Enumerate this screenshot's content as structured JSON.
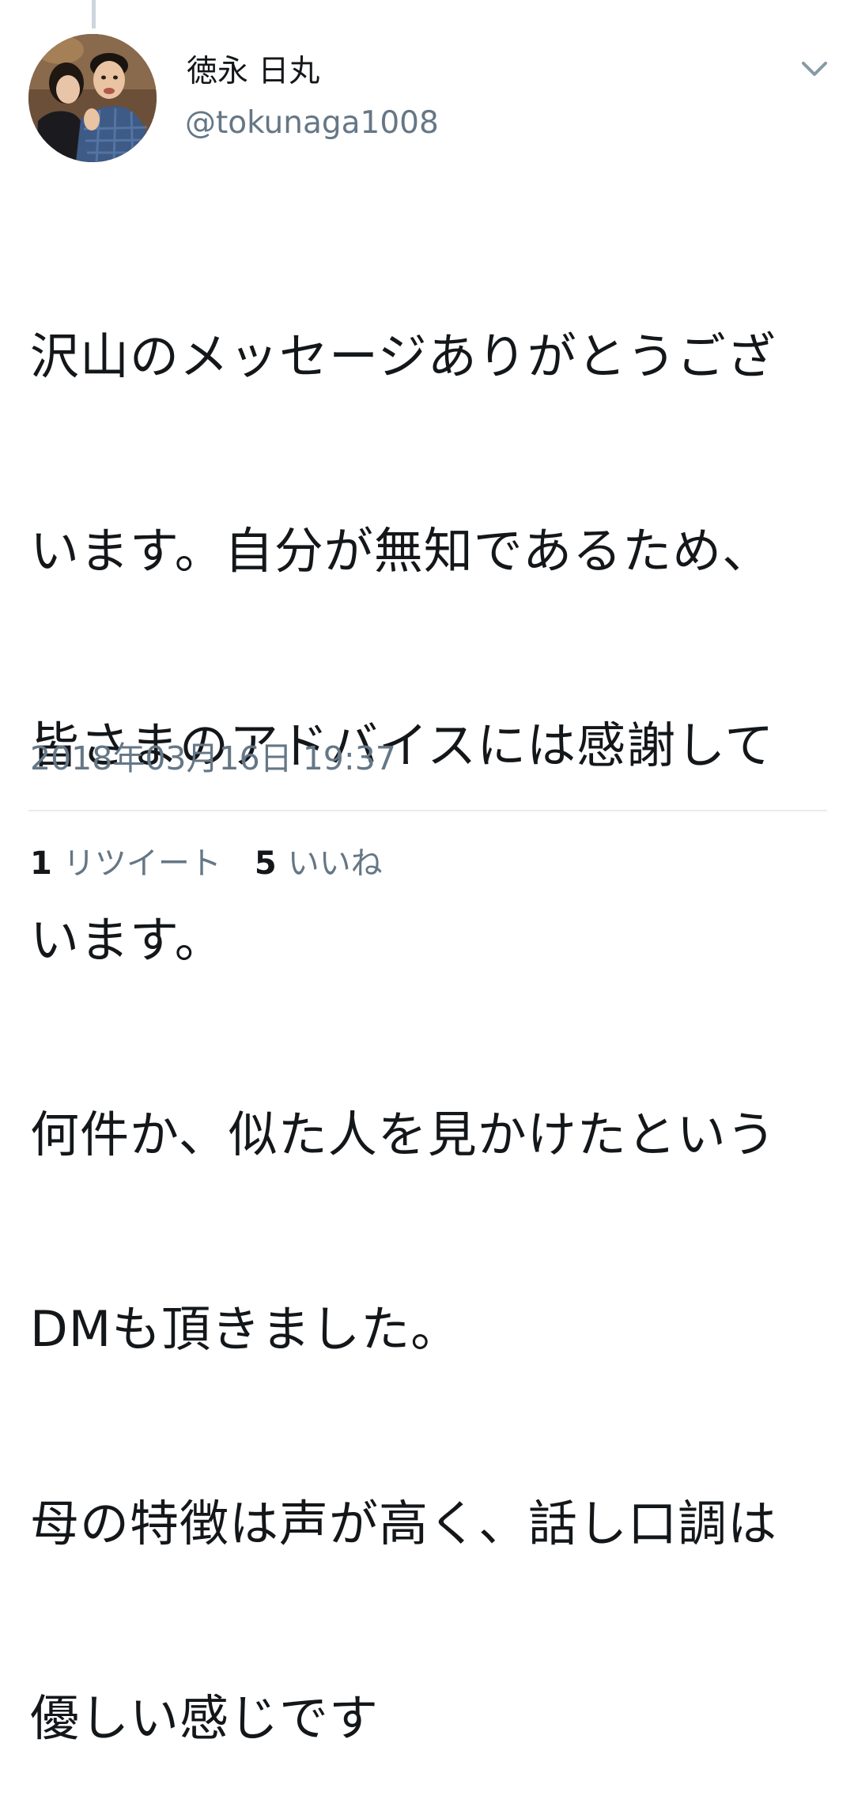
{
  "tweet": {
    "author": {
      "display_name": "徳永 日丸",
      "handle": "@tokunaga1008"
    },
    "text_lines": [
      "沢山のメッセージありがとうござ",
      "います。自分が無知であるため、",
      "皆さまのアドバイスには感謝して",
      "います。",
      "何件か、似た人を見かけたという",
      "DMも頂きました。",
      "母の特徴は声が高く、話し口調は",
      "優しい感じです"
    ],
    "timestamp": "2018年03月16日 19:37",
    "stats": {
      "retweets_count": "1",
      "retweets_label": "リツイート",
      "likes_count": "5",
      "likes_label": "いいね"
    }
  },
  "icons": {
    "menu": "chevron-down-icon",
    "avatar": "profile-photo"
  },
  "colors": {
    "primary_text": "#14171a",
    "secondary_text": "#657786",
    "divider": "#e6ecf0",
    "thread_line": "#ccd6dd"
  }
}
